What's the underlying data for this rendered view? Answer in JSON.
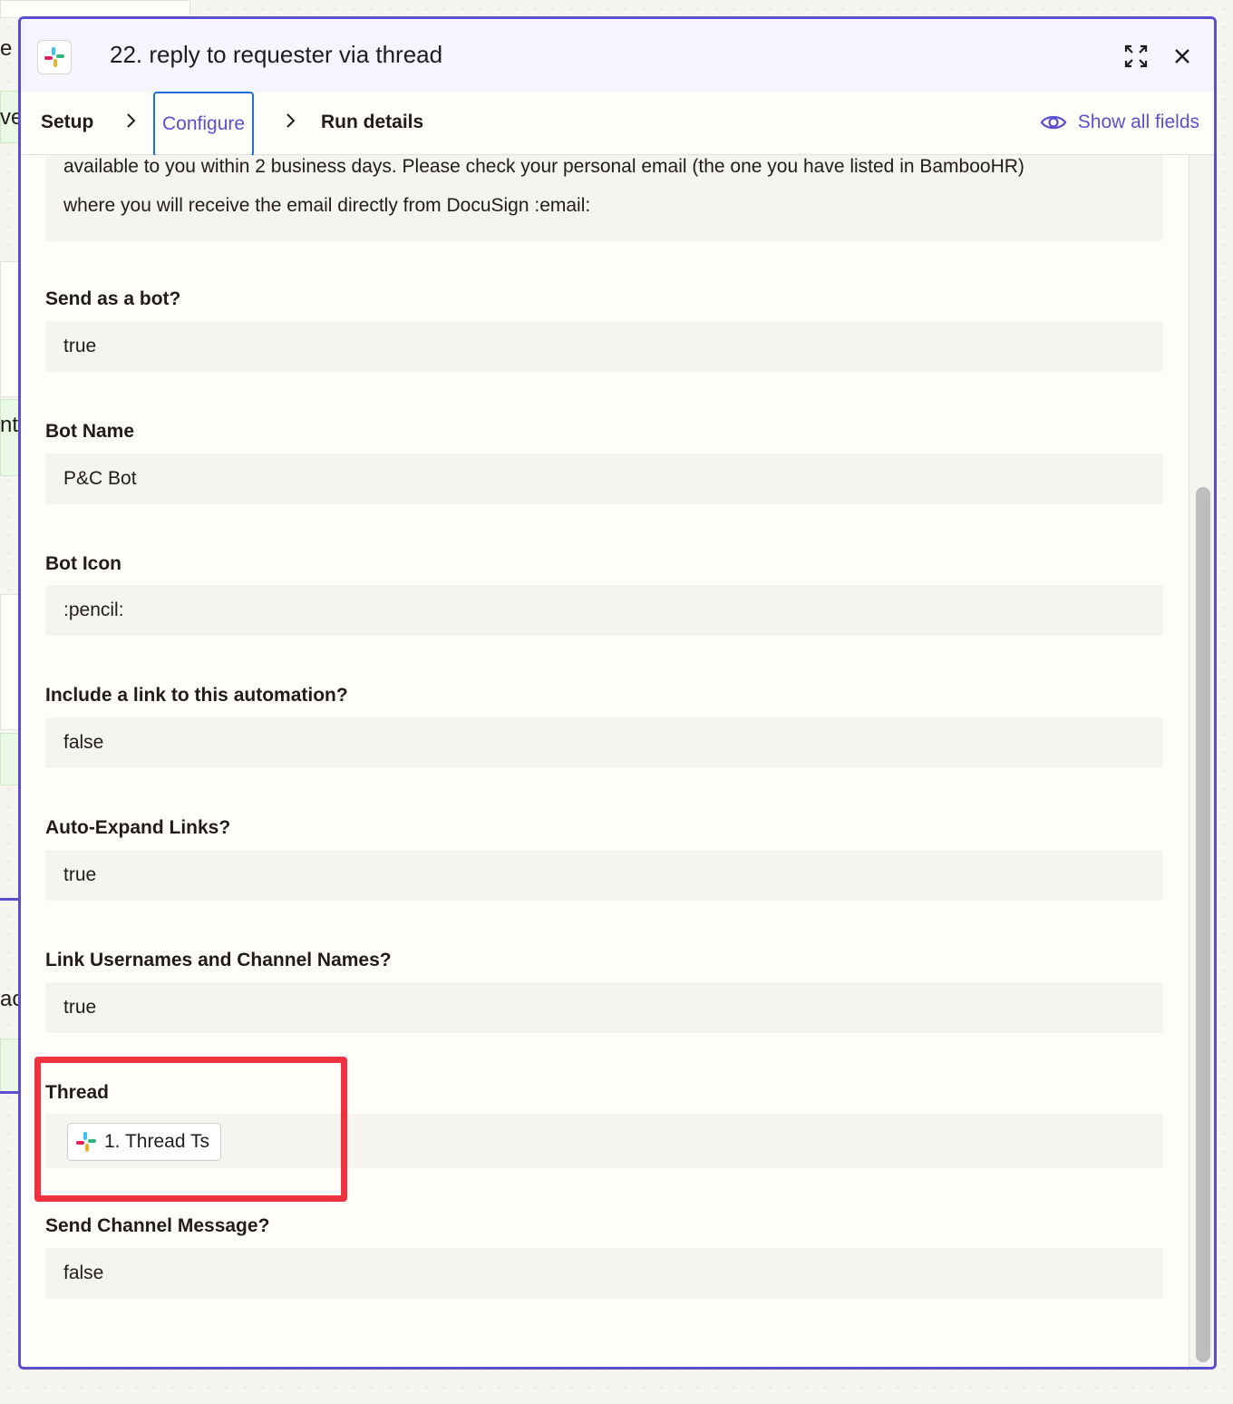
{
  "window": {
    "title": "22. reply to requester via thread",
    "expand_icon": "expand-icon",
    "close_icon": "close-icon"
  },
  "tabs": [
    {
      "label": "Setup"
    },
    {
      "label": "Configure"
    },
    {
      "label": "Run details"
    }
  ],
  "show_all_fields": "Show all fields",
  "message_text_tail": {
    "line1": "available to you within 2 business days. Please check your personal email (the one you have listed in BambooHR)",
    "line2": "where you will receive the email directly from DocuSign :email:"
  },
  "fields": [
    {
      "label": "Send as a bot?",
      "value": "true"
    },
    {
      "label": "Bot Name",
      "value": "P&C Bot"
    },
    {
      "label": "Bot Icon",
      "value": ":pencil:"
    },
    {
      "label": "Include a link to this automation?",
      "value": "false"
    },
    {
      "label": "Auto-Expand Links?",
      "value": "true"
    },
    {
      "label": "Link Usernames and Channel Names?",
      "value": "true"
    },
    {
      "label": "Thread",
      "value": "1. Thread Ts"
    },
    {
      "label": "Send Channel Message?",
      "value": "false"
    }
  ],
  "background_fragments": {
    "frag1": "e [",
    "frag2": "ve",
    "frag3": "nt",
    "frag4": "ac"
  },
  "colors": {
    "accent": "#5b4fd0",
    "highlight": "#f0313f",
    "focus": "#1d6fd8"
  }
}
